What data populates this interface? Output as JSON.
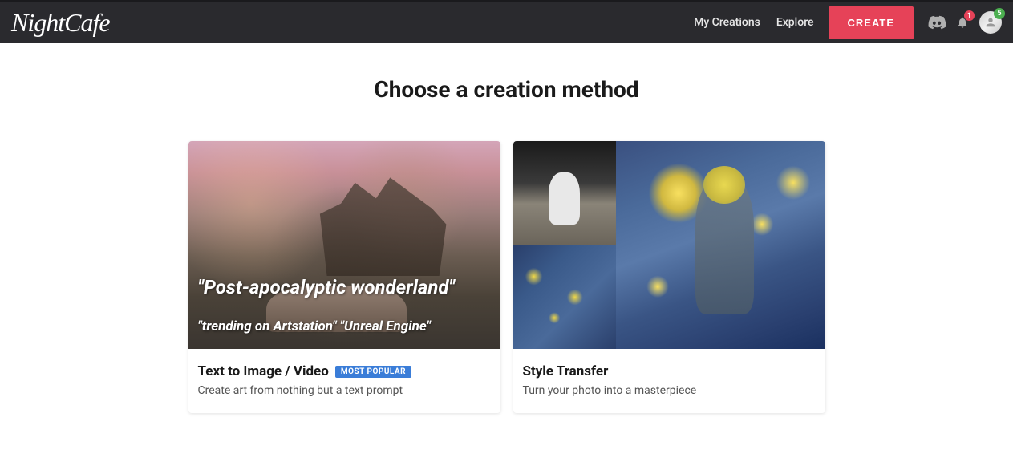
{
  "header": {
    "logo": "NightCafe",
    "nav": {
      "my_creations": "My Creations",
      "explore": "Explore"
    },
    "create_button": "CREATE",
    "notifications_count": "1",
    "credits_count": "5"
  },
  "main": {
    "title": "Choose a creation method",
    "cards": [
      {
        "title": "Text to Image / Video",
        "badge": "MOST POPULAR",
        "description": "Create art from nothing but a text prompt",
        "image_text_1": "\"Post-apocalyptic wonderland\"",
        "image_text_2": "\"trending on Artstation\" \"Unreal Engine\""
      },
      {
        "title": "Style Transfer",
        "badge": "",
        "description": "Turn your photo into a masterpiece"
      }
    ]
  }
}
